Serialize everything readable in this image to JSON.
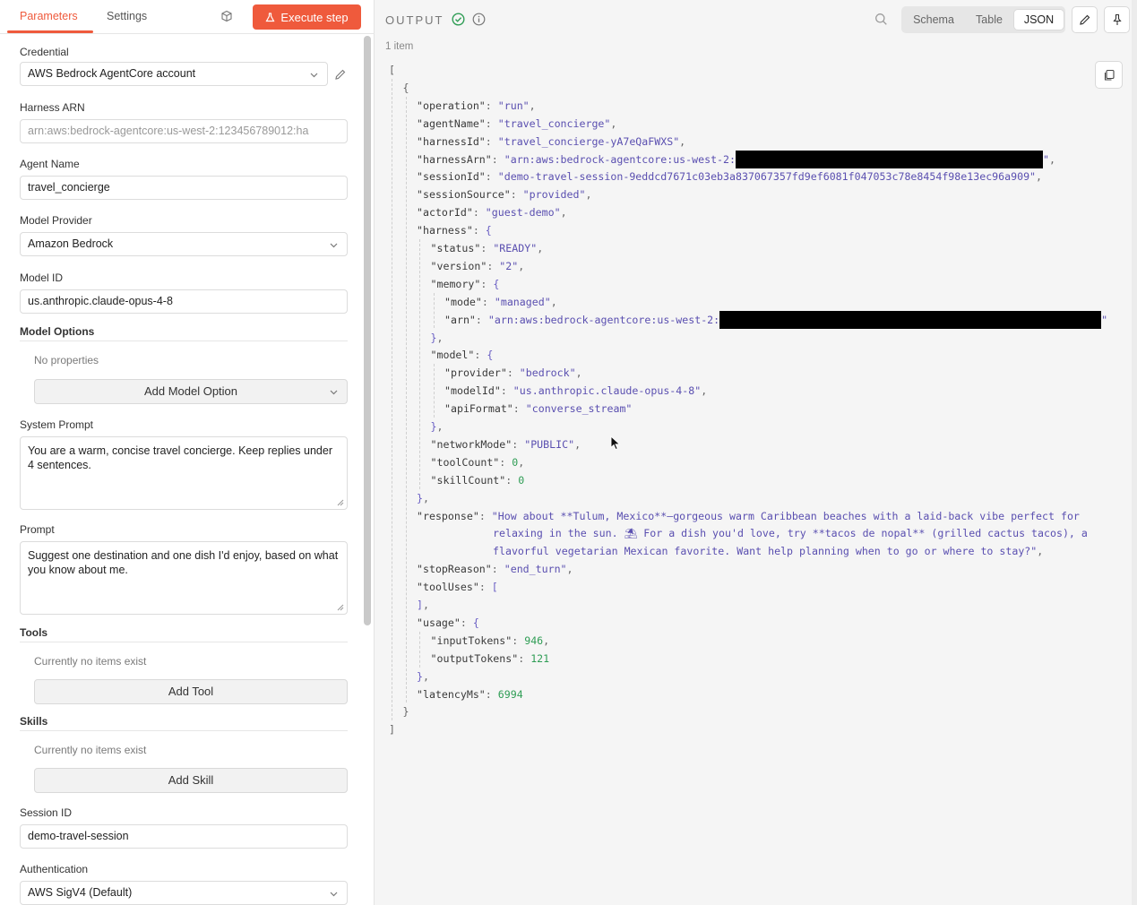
{
  "tabs": {
    "parameters": "Parameters",
    "settings": "Settings"
  },
  "execute_label": "Execute step",
  "form": {
    "credential_label": "Credential",
    "credential_value": "AWS Bedrock AgentCore account",
    "harness_arn_label": "Harness ARN",
    "harness_arn_value": "arn:aws:bedrock-agentcore:us-west-2:123456789012:ha",
    "agent_name_label": "Agent Name",
    "agent_name_value": "travel_concierge",
    "model_provider_label": "Model Provider",
    "model_provider_value": "Amazon Bedrock",
    "model_id_label": "Model ID",
    "model_id_value": "us.anthropic.claude-opus-4-8",
    "model_options_label": "Model Options",
    "model_options_empty": "No properties",
    "add_model_option": "Add Model Option",
    "system_prompt_label": "System Prompt",
    "system_prompt_value": "You are a warm, concise travel concierge. Keep replies under 4 sentences.",
    "prompt_label": "Prompt",
    "prompt_value": "Suggest one destination and one dish I'd enjoy, based on what you know about me.",
    "tools_label": "Tools",
    "tools_empty": "Currently no items exist",
    "add_tool": "Add Tool",
    "skills_label": "Skills",
    "skills_empty": "Currently no items exist",
    "add_skill": "Add Skill",
    "session_id_label": "Session ID",
    "session_id_value": "demo-travel-session",
    "auth_label": "Authentication",
    "auth_value": "AWS SigV4 (Default)"
  },
  "output": {
    "title": "OUTPUT",
    "view_modes": [
      "Schema",
      "Table",
      "JSON"
    ],
    "active_view": "JSON",
    "items_count": "1 item"
  },
  "json_lines": [
    {
      "indent": 0,
      "parts": [
        [
          "p",
          "["
        ]
      ]
    },
    {
      "indent": 1,
      "parts": [
        [
          "p",
          "{"
        ]
      ]
    },
    {
      "indent": 2,
      "parts": [
        [
          "k",
          "\"operation\""
        ],
        [
          "p",
          ": "
        ],
        [
          "s",
          "\"run\""
        ],
        [
          "p",
          ","
        ]
      ]
    },
    {
      "indent": 2,
      "parts": [
        [
          "k",
          "\"agentName\""
        ],
        [
          "p",
          ": "
        ],
        [
          "s",
          "\"travel_concierge\""
        ],
        [
          "p",
          ","
        ]
      ]
    },
    {
      "indent": 2,
      "parts": [
        [
          "k",
          "\"harnessId\""
        ],
        [
          "p",
          ": "
        ],
        [
          "s",
          "\"travel_concierge-yA7eQaFWXS\""
        ],
        [
          "p",
          ","
        ]
      ]
    },
    {
      "indent": 2,
      "parts": [
        [
          "k",
          "\"harnessArn\""
        ],
        [
          "p",
          ": "
        ],
        [
          "s",
          "\"arn:aws:bedrock-agentcore:us-west-2:"
        ],
        [
          "r",
          "343"
        ],
        [
          "s",
          "\""
        ],
        [
          "p",
          ","
        ]
      ]
    },
    {
      "indent": 2,
      "parts": [
        [
          "k",
          "\"sessionId\""
        ],
        [
          "p",
          ": "
        ],
        [
          "s",
          "\"demo-travel-session-9eddcd7671c03eb3a837067357fd9ef6081f047053c78e8454f98e13ec96a909\""
        ],
        [
          "p",
          ","
        ]
      ]
    },
    {
      "indent": 2,
      "parts": [
        [
          "k",
          "\"sessionSource\""
        ],
        [
          "p",
          ": "
        ],
        [
          "s",
          "\"provided\""
        ],
        [
          "p",
          ","
        ]
      ]
    },
    {
      "indent": 2,
      "parts": [
        [
          "k",
          "\"actorId\""
        ],
        [
          "p",
          ": "
        ],
        [
          "s",
          "\"guest-demo\""
        ],
        [
          "p",
          ","
        ]
      ]
    },
    {
      "indent": 2,
      "parts": [
        [
          "k",
          "\"harness\""
        ],
        [
          "p",
          ": "
        ],
        [
          "b",
          "{"
        ]
      ]
    },
    {
      "indent": 3,
      "parts": [
        [
          "k",
          "\"status\""
        ],
        [
          "p",
          ": "
        ],
        [
          "s",
          "\"READY\""
        ],
        [
          "p",
          ","
        ]
      ]
    },
    {
      "indent": 3,
      "parts": [
        [
          "k",
          "\"version\""
        ],
        [
          "p",
          ": "
        ],
        [
          "s",
          "\"2\""
        ],
        [
          "p",
          ","
        ]
      ]
    },
    {
      "indent": 3,
      "parts": [
        [
          "k",
          "\"memory\""
        ],
        [
          "p",
          ": "
        ],
        [
          "b",
          "{"
        ]
      ]
    },
    {
      "indent": 4,
      "parts": [
        [
          "k",
          "\"mode\""
        ],
        [
          "p",
          ": "
        ],
        [
          "s",
          "\"managed\""
        ],
        [
          "p",
          ","
        ]
      ]
    },
    {
      "indent": 4,
      "parts": [
        [
          "k",
          "\"arn\""
        ],
        [
          "p",
          ": "
        ],
        [
          "s",
          "\"arn:aws:bedrock-agentcore:us-west-2:"
        ],
        [
          "r",
          "426"
        ],
        [
          "s",
          "\""
        ]
      ]
    },
    {
      "indent": 3,
      "parts": [
        [
          "b",
          "}"
        ],
        [
          "p",
          ","
        ]
      ]
    },
    {
      "indent": 3,
      "parts": [
        [
          "k",
          "\"model\""
        ],
        [
          "p",
          ": "
        ],
        [
          "b",
          "{"
        ]
      ]
    },
    {
      "indent": 4,
      "parts": [
        [
          "k",
          "\"provider\""
        ],
        [
          "p",
          ": "
        ],
        [
          "s",
          "\"bedrock\""
        ],
        [
          "p",
          ","
        ]
      ]
    },
    {
      "indent": 4,
      "parts": [
        [
          "k",
          "\"modelId\""
        ],
        [
          "p",
          ": "
        ],
        [
          "s",
          "\"us.anthropic.claude-opus-4-8\""
        ],
        [
          "p",
          ","
        ]
      ]
    },
    {
      "indent": 4,
      "parts": [
        [
          "k",
          "\"apiFormat\""
        ],
        [
          "p",
          ": "
        ],
        [
          "s",
          "\"converse_stream\""
        ]
      ]
    },
    {
      "indent": 3,
      "parts": [
        [
          "b",
          "}"
        ],
        [
          "p",
          ","
        ]
      ]
    },
    {
      "indent": 3,
      "parts": [
        [
          "k",
          "\"networkMode\""
        ],
        [
          "p",
          ": "
        ],
        [
          "s",
          "\"PUBLIC\""
        ],
        [
          "p",
          ","
        ]
      ]
    },
    {
      "indent": 3,
      "parts": [
        [
          "k",
          "\"toolCount\""
        ],
        [
          "p",
          ": "
        ],
        [
          "n",
          "0"
        ],
        [
          "p",
          ","
        ]
      ]
    },
    {
      "indent": 3,
      "parts": [
        [
          "k",
          "\"skillCount\""
        ],
        [
          "p",
          ": "
        ],
        [
          "n",
          "0"
        ]
      ]
    },
    {
      "indent": 2,
      "parts": [
        [
          "b",
          "}"
        ],
        [
          "p",
          ","
        ]
      ]
    },
    {
      "indent": 2,
      "parts": [
        [
          "k",
          "\"response\""
        ],
        [
          "p",
          ": "
        ],
        [
          "s",
          "\"How about **Tulum, Mexico**—gorgeous warm Caribbean beaches with a laid-back vibe perfect for"
        ]
      ]
    },
    {
      "indent": 2,
      "pad": 85,
      "parts": [
        [
          "s",
          "relaxing in the sun. ⛱ For a dish you'd love, try **tacos de nopal** (grilled cactus tacos), a"
        ]
      ]
    },
    {
      "indent": 2,
      "pad": 85,
      "parts": [
        [
          "s",
          "flavorful vegetarian Mexican favorite. Want help planning when to go or where to stay?\""
        ],
        [
          "p",
          ","
        ]
      ]
    },
    {
      "indent": 2,
      "parts": [
        [
          "k",
          "\"stopReason\""
        ],
        [
          "p",
          ": "
        ],
        [
          "s",
          "\"end_turn\""
        ],
        [
          "p",
          ","
        ]
      ]
    },
    {
      "indent": 2,
      "parts": [
        [
          "k",
          "\"toolUses\""
        ],
        [
          "p",
          ": "
        ],
        [
          "b",
          "["
        ]
      ]
    },
    {
      "indent": 2,
      "parts": [
        [
          "b",
          "]"
        ],
        [
          "p",
          ","
        ]
      ]
    },
    {
      "indent": 2,
      "parts": [
        [
          "k",
          "\"usage\""
        ],
        [
          "p",
          ": "
        ],
        [
          "b",
          "{"
        ]
      ]
    },
    {
      "indent": 3,
      "parts": [
        [
          "k",
          "\"inputTokens\""
        ],
        [
          "p",
          ": "
        ],
        [
          "n",
          "946"
        ],
        [
          "p",
          ","
        ]
      ]
    },
    {
      "indent": 3,
      "parts": [
        [
          "k",
          "\"outputTokens\""
        ],
        [
          "p",
          ": "
        ],
        [
          "n",
          "121"
        ]
      ]
    },
    {
      "indent": 2,
      "parts": [
        [
          "b",
          "}"
        ],
        [
          "p",
          ","
        ]
      ]
    },
    {
      "indent": 2,
      "parts": [
        [
          "k",
          "\"latencyMs\""
        ],
        [
          "p",
          ": "
        ],
        [
          "n",
          "6994"
        ]
      ]
    },
    {
      "indent": 1,
      "parts": [
        [
          "p",
          "}"
        ]
      ]
    },
    {
      "indent": 0,
      "parts": [
        [
          "p",
          "]"
        ]
      ]
    }
  ],
  "colors": {
    "accent": "#ef5a3c",
    "success": "#2f9d55",
    "string": "#5a4fb0"
  }
}
